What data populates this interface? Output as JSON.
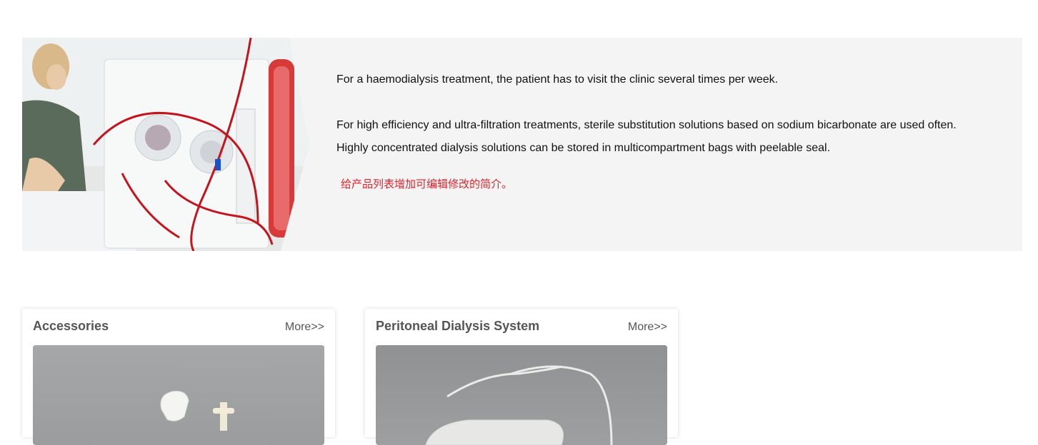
{
  "intro": {
    "image_subject": "dialysis-machine-photo",
    "paragraph_1": "For a haemodialysis treatment, the patient has to visit the clinic several times per week.",
    "paragraph_2": "For high efficiency and ultra-filtration treatments, sterile substitution solutions based on sodium bicarbonate are used often.",
    "paragraph_3": "Highly concentrated dialysis solutions can be stored in multicompartment bags with peelable seal.",
    "note": "给产品列表增加可编辑修改的简介。",
    "note_color": "#e0242c",
    "background_color": "#f4f4f4"
  },
  "cards": [
    {
      "title": "Accessories",
      "more_label": "More>>",
      "image_subject": "accessories-product-photo"
    },
    {
      "title": "Peritoneal Dialysis System",
      "more_label": "More>>",
      "image_subject": "peritoneal-dialysis-bag-photo"
    }
  ]
}
